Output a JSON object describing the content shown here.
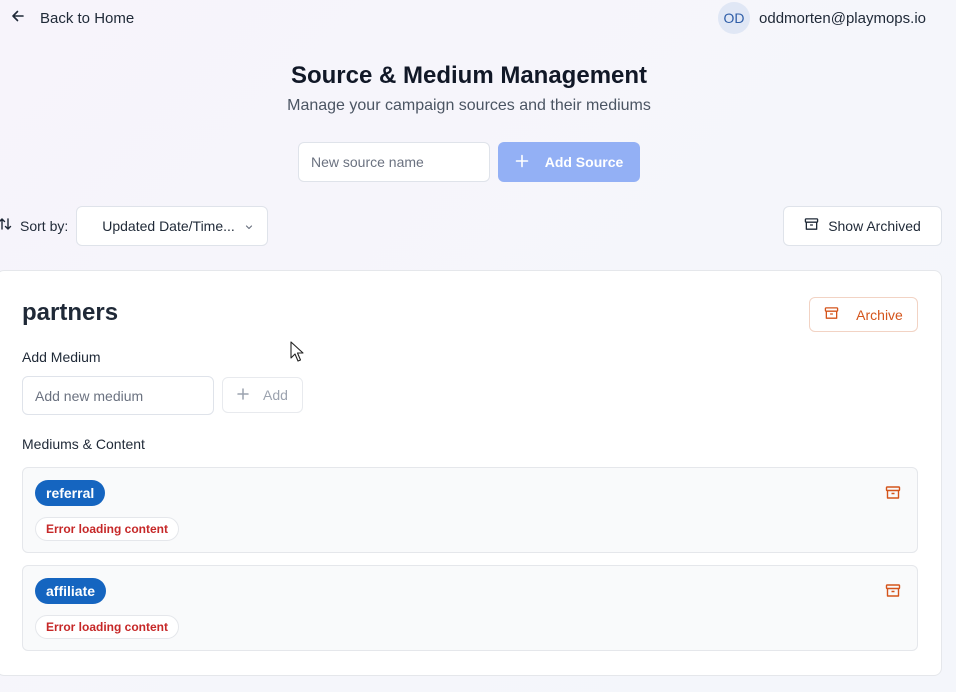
{
  "nav": {
    "back_label": "Back to Home"
  },
  "user": {
    "initials": "OD",
    "email": "oddmorten@playmops.io"
  },
  "header": {
    "title": "Source & Medium Management",
    "subtitle": "Manage your campaign sources and their mediums"
  },
  "new_source": {
    "placeholder": "New source name",
    "value": "",
    "button_label": "Add Source"
  },
  "sort": {
    "label": "Sort by:",
    "selected": "Updated Date/Time..."
  },
  "archived_toggle": {
    "label": "Show Archived"
  },
  "source": {
    "name": "partners",
    "archive_label": "Archive",
    "add_medium_label": "Add Medium",
    "medium_placeholder": "Add new medium",
    "add_button_label": "Add",
    "mediums_label": "Mediums & Content",
    "mediums": [
      {
        "name": "referral",
        "status": "Error loading content"
      },
      {
        "name": "affiliate",
        "status": "Error loading content"
      }
    ]
  },
  "colors": {
    "primary_disabled": "#93b0f5",
    "pill": "#1565c0",
    "archive": "#d4541b",
    "error": "#c62828"
  },
  "icons": [
    "arrow-left-icon",
    "plus-icon",
    "sort-icon",
    "chevron-down-icon",
    "archive-icon"
  ]
}
